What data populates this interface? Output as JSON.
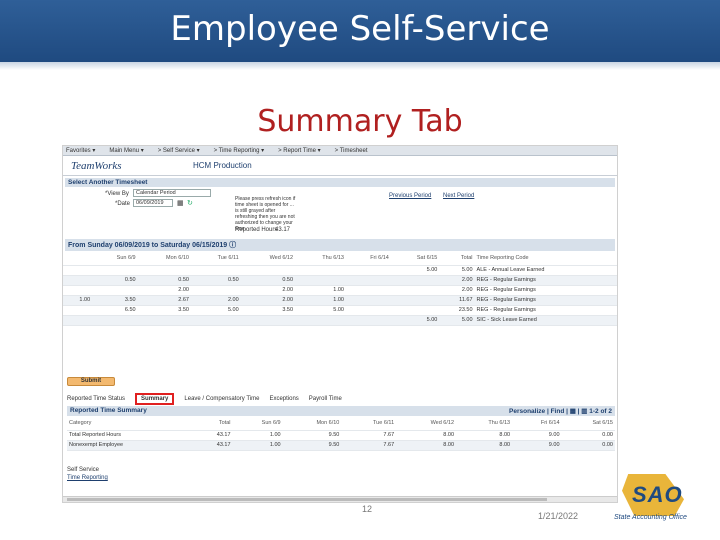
{
  "slide": {
    "title": "Employee Self-Service",
    "subtitle": "Summary Tab",
    "page_number": "12",
    "date": "1/21/2022",
    "logo_text": "SAO",
    "logo_subtext": "State Accounting Office",
    "colors": {
      "banner": "#1f4a80",
      "subtitle": "#b02020",
      "highlight": "#e02020",
      "logo_gold": "#e9b53a"
    }
  },
  "app": {
    "menu": [
      "Favorites ▾",
      "Main Menu ▾",
      "> Self Service ▾",
      "> Time Reporting ▾",
      "> Report Time ▾",
      "> Timesheet"
    ],
    "logo": "TeamWorks",
    "product": "HCM Production",
    "select_section": "Select Another Timesheet",
    "view_by_label": "*View By",
    "view_by_value": "Calendar Period",
    "date_label": "*Date",
    "date_value": "06/09/2019",
    "refresh_note": "Please press refresh icon if time sheet is opened for ... is still grayed after refreshing then you are not authorized to change your time.",
    "reported_hours_label": "Reported Hours",
    "reported_hours_value": "43.17",
    "prev_period": "Previous Period",
    "next_period": "Next Period",
    "range_header": "From Sunday 06/09/2019 to Saturday 06/15/2019",
    "timesheet": {
      "headers": [
        "",
        "Sun 6/9",
        "Mon 6/10",
        "Tue 6/11",
        "Wed 6/12",
        "Thu 6/13",
        "Fri 6/14",
        "Sat 6/15",
        "Total",
        "Time Reporting Code"
      ],
      "rows": [
        [
          "",
          "",
          "",
          "",
          "",
          "",
          "",
          "5.00",
          "5.00",
          "ALE - Annual Leave Earned"
        ],
        [
          "",
          "0.50",
          "0.50",
          "0.50",
          "0.50",
          "",
          "",
          "",
          "2.00",
          "REG - Regular Earnings"
        ],
        [
          "",
          "",
          "2.00",
          "",
          "2.00",
          "1.00",
          "",
          "",
          "2.00",
          "REG - Regular Earnings"
        ],
        [
          "1.00",
          "3.50",
          "2.67",
          "2.00",
          "2.00",
          "1.00",
          "",
          "",
          "11.67",
          "REG - Regular Earnings"
        ],
        [
          "",
          "6.50",
          "3.50",
          "5.00",
          "3.50",
          "5.00",
          "",
          "",
          "23.50",
          "REG - Regular Earnings"
        ],
        [
          "",
          "",
          "",
          "",
          "",
          "",
          "",
          "5.00",
          "5.00",
          "SIC - Sick Leave Earned"
        ]
      ]
    },
    "submit_label": "Submit",
    "tabs": [
      "Reported Time Status",
      "Summary",
      "Leave / Compensatory Time",
      "Exceptions",
      "Payroll Time"
    ],
    "active_tab": "Summary",
    "summary_header": "Reported Time Summary",
    "summary_tools": "Personalize | Find | ▦ | ▥  1-2 of 2",
    "summary": {
      "headers": [
        "Category",
        "Total",
        "Sun 6/9",
        "Mon 6/10",
        "Tue 6/11",
        "Wed 6/12",
        "Thu 6/13",
        "Fri 6/14",
        "Sat 6/15"
      ],
      "rows": [
        [
          "Total Reported Hours",
          "43.17",
          "1.00",
          "9.50",
          "7.67",
          "8.00",
          "8.00",
          "9.00",
          "0.00"
        ],
        [
          "Nonexempt Employee",
          "43.17",
          "1.00",
          "9.50",
          "7.67",
          "8.00",
          "8.00",
          "9.00",
          "0.00"
        ]
      ]
    },
    "footer_links": [
      "Self Service",
      "Time Reporting"
    ]
  }
}
